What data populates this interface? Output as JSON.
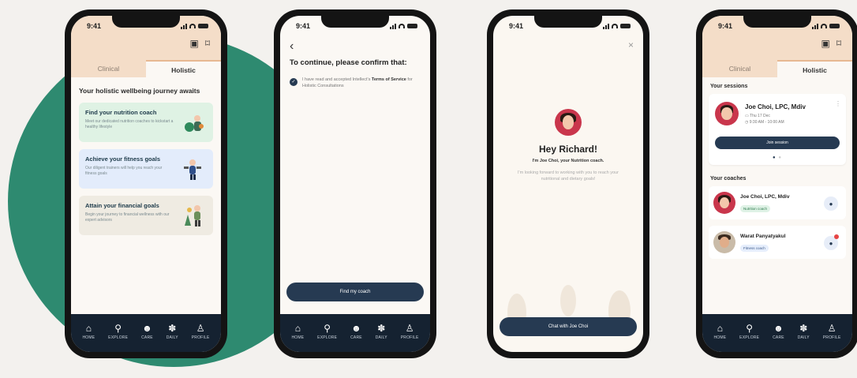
{
  "status": {
    "time": "9:41"
  },
  "nav": [
    {
      "icon": "home-icon",
      "glyph": "⌂",
      "label": "HOME"
    },
    {
      "icon": "search-icon",
      "glyph": "⚲",
      "label": "EXPLORE"
    },
    {
      "icon": "care-icon",
      "glyph": "☻",
      "label": "CARE"
    },
    {
      "icon": "daily-icon",
      "glyph": "✽",
      "label": "DAILY"
    },
    {
      "icon": "profile-icon",
      "glyph": "♙",
      "label": "PROFILE"
    }
  ],
  "tabs": {
    "clinical": "Clinical",
    "holistic": "Holistic"
  },
  "screen1": {
    "heading": "Your holistic wellbeing journey awaits",
    "cards": [
      {
        "title": "Find your nutrition coach",
        "desc": "Meet our dedicated nutrition coaches to kickstart a healthy lifestyle",
        "color": "#dff2e4"
      },
      {
        "title": "Achieve your fitness goals",
        "desc": "Our diligent trainers will help you reach your fitness goals",
        "color": "#e3ecfb"
      },
      {
        "title": "Attain your financial goals",
        "desc": "Begin your journey to financial wellness with our expert advisors",
        "color": "#efebe2"
      }
    ]
  },
  "screen2": {
    "back": "‹",
    "title": "To continue, please confirm that:",
    "consent_pre": "I have read and accepted Intellect's ",
    "consent_link": "Terms of Service",
    "consent_post": " for Holistic Consultations",
    "button": "Find my coach"
  },
  "screen3": {
    "close": "×",
    "greeting": "Hey Richard!",
    "intro": "I'm Joe Choi, your Nutrition coach.",
    "message": "I'm looking forward to working with you to reach your nutritional and dietary goals!",
    "button": "Chat with Joe Choi"
  },
  "screen4": {
    "sessions_title": "Your sessions",
    "session": {
      "name": "Joe Choi, LPC, Mdiv",
      "date": "Thu 17 Dec",
      "time": "9:30 AM - 10:00 AM",
      "button": "Join session"
    },
    "coaches_title": "Your coaches",
    "coaches": [
      {
        "name": "Joe Choi, LPC, Mdiv",
        "tag": "Nutrition coach"
      },
      {
        "name": "Warat Panyatyakul",
        "tag": "Fitness coach"
      }
    ]
  }
}
